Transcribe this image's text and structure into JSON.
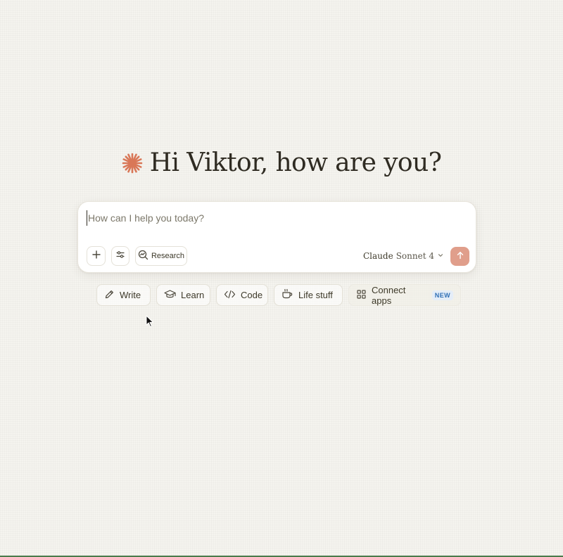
{
  "greeting": {
    "text": "Hi Viktor, how are you?"
  },
  "composer": {
    "placeholder": "How can I help you today?",
    "research_label": "Research",
    "model_name": "Claude",
    "model_version": "Sonnet 4"
  },
  "chips": {
    "write": "Write",
    "learn": "Learn",
    "code": "Code",
    "life": "Life stuff",
    "connect": "Connect apps",
    "connect_badge": "NEW"
  },
  "icons": {
    "brand": "spark-icon",
    "add": "plus-icon",
    "tools": "sliders-icon",
    "research": "research-icon",
    "model_dropdown": "chevron-down-icon",
    "send": "arrow-up-icon",
    "write": "pencil-icon",
    "learn": "graduation-cap-icon",
    "code": "code-icon",
    "life": "coffee-cup-icon",
    "connect": "apps-grid-icon"
  },
  "colors": {
    "background": "#f5f4ef",
    "accent": "#d97757",
    "send_button": "#e09e8b",
    "badge_text": "#2f6fb5",
    "badge_bg": "#e4edf8"
  }
}
